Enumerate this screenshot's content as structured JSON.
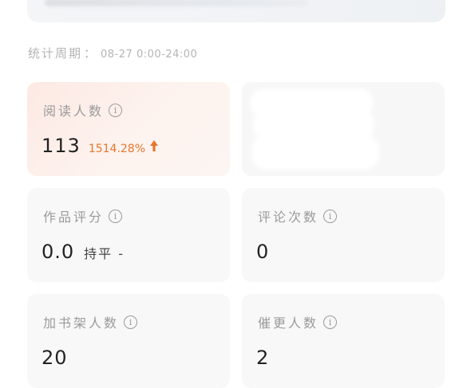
{
  "period": {
    "label": "统计周期",
    "sep": "：",
    "range": "08-27 0:00-24:00"
  },
  "cards": {
    "read": {
      "label": "阅读人数",
      "value": "113",
      "change": "1514.28%"
    },
    "rating": {
      "label": "作品评分",
      "value": "0.0",
      "note": "持平 -"
    },
    "comment": {
      "label": "评论次数",
      "value": "0"
    },
    "shelf": {
      "label": "加书架人数",
      "value": "20"
    },
    "urge": {
      "label": "催更人数",
      "value": "2"
    }
  },
  "colors": {
    "accent": "#e8762b",
    "hot_card_bg": "#fde9e3",
    "card_bg": "#f8f8f8",
    "label": "#9a9a9a"
  },
  "icons": {
    "info": "info-circle-icon",
    "trend": "arrow-up-icon"
  }
}
